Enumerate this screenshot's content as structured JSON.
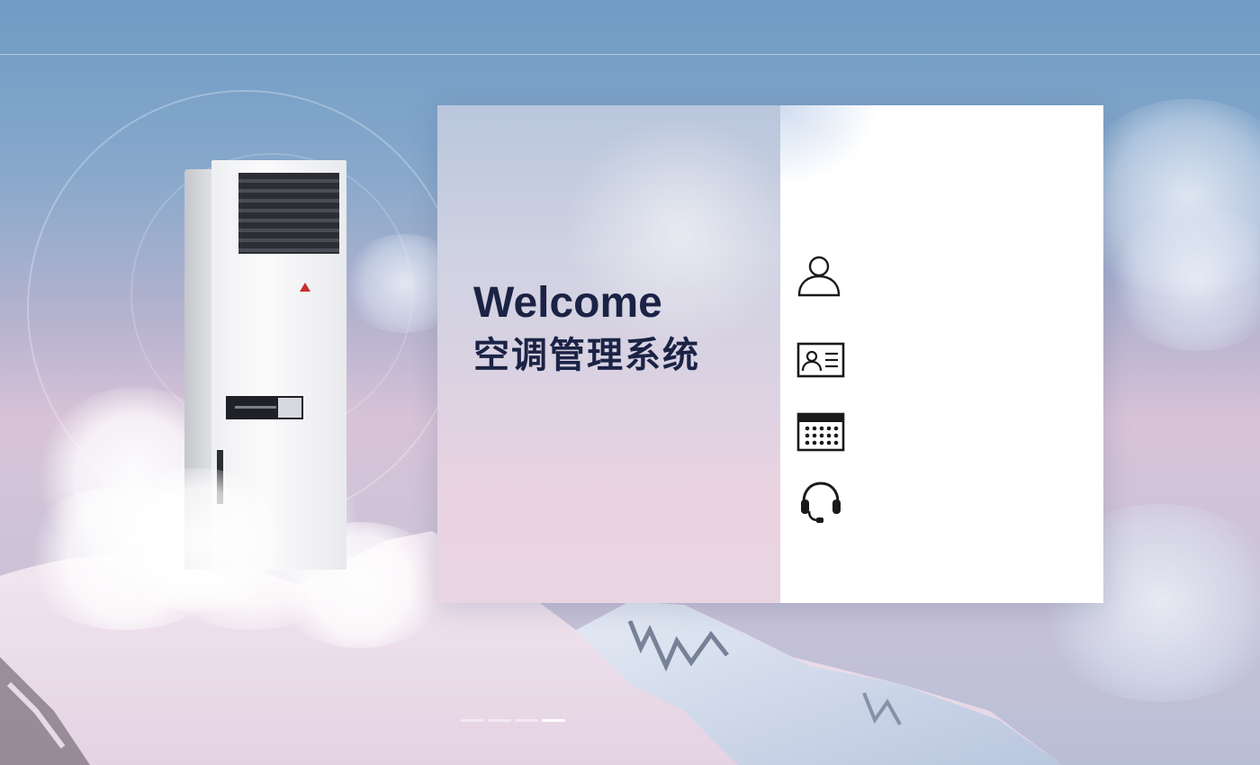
{
  "hero": {
    "welcome": "Welcome",
    "title": "空调管理系统"
  },
  "form": {
    "fields": [
      {
        "icon": "user-icon",
        "value": "",
        "placeholder": ""
      },
      {
        "icon": "id-card-icon",
        "value": "",
        "placeholder": ""
      },
      {
        "icon": "calendar-icon",
        "value": "",
        "placeholder": ""
      },
      {
        "icon": "headset-icon",
        "value": "",
        "placeholder": ""
      }
    ]
  },
  "carousel": {
    "slides": 4,
    "active": 4
  },
  "colors": {
    "title": "#1b2345",
    "panel_right": "#ffffff",
    "icon": "#1a1a1a"
  }
}
